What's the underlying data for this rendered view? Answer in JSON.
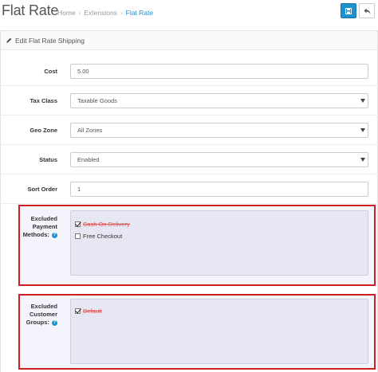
{
  "header": {
    "title": "Flat Rate",
    "breadcrumb": [
      {
        "label": "Home"
      },
      {
        "label": "Extensions"
      },
      {
        "label": "Flat Rate"
      }
    ],
    "separator": "›"
  },
  "panel": {
    "heading": "Edit Flat Rate Shipping"
  },
  "form": {
    "cost": {
      "label": "Cost",
      "value": "5.00"
    },
    "tax_class": {
      "label": "Tax Class",
      "value": "Taxable Goods"
    },
    "geo_zone": {
      "label": "Geo Zone",
      "value": "All Zones"
    },
    "status": {
      "label": "Status",
      "value": "Enabled"
    },
    "sort_order": {
      "label": "Sort Order",
      "value": "1"
    },
    "excluded_payment": {
      "label_line1": "Excluded",
      "label_line2": "Payment",
      "label_line3": "Methods:",
      "help": "?",
      "options": [
        {
          "label": "Cash On Delivery",
          "checked": true
        },
        {
          "label": "Free Checkout",
          "checked": false
        }
      ]
    },
    "excluded_groups": {
      "label_line1": "Excluded",
      "label_line2": "Customer",
      "label_line3": "Groups:",
      "help": "?",
      "options": [
        {
          "label": "Default",
          "checked": true
        }
      ]
    }
  },
  "colors": {
    "primary": "#1e91cf",
    "highlight_border": "#cc1f1f",
    "strike_text": "#d9534f"
  }
}
